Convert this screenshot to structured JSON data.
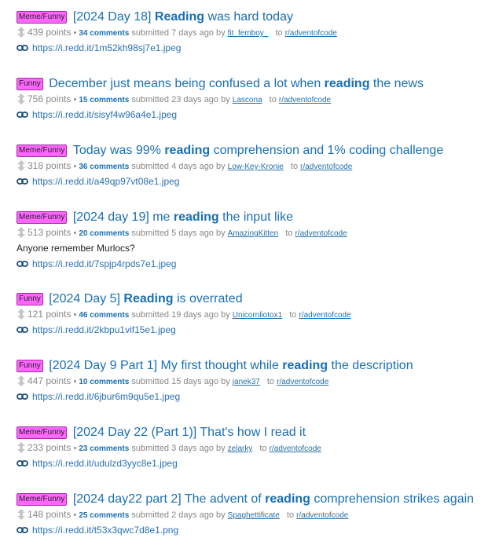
{
  "posts": [
    {
      "flair": "Meme/Funny",
      "title_segments": [
        {
          "t": "[2024 Day 18] ",
          "b": false
        },
        {
          "t": "Reading",
          "b": true
        },
        {
          "t": " was hard today",
          "b": false
        }
      ],
      "points": "439 points",
      "comments": "34 comments",
      "submitted": "submitted 7 days ago by",
      "author": "fit_femboy_",
      "to": "to",
      "subreddit": "r/adventofcode",
      "selftext": "",
      "url": "https://i.redd.it/1m52kh98sj7e1.jpeg"
    },
    {
      "flair": "Funny",
      "title_segments": [
        {
          "t": "December just means being confused a lot when ",
          "b": false
        },
        {
          "t": "reading",
          "b": true
        },
        {
          "t": " the news",
          "b": false
        }
      ],
      "points": "756 points",
      "comments": "15 comments",
      "submitted": "submitted 23 days ago by",
      "author": "Lascona",
      "to": "to",
      "subreddit": "r/adventofcode",
      "selftext": "",
      "url": "https://i.redd.it/sisyf4w96a4e1.jpeg"
    },
    {
      "flair": "Meme/Funny",
      "title_segments": [
        {
          "t": "Today was 99% ",
          "b": false
        },
        {
          "t": "reading",
          "b": true
        },
        {
          "t": " comprehension and 1% coding challenge",
          "b": false
        }
      ],
      "points": "318 points",
      "comments": "36 comments",
      "submitted": "submitted 4 days ago by",
      "author": "Low-Key-Kronie",
      "to": "to",
      "subreddit": "r/adventofcode",
      "selftext": "",
      "url": "https://i.redd.it/a49qp97vt08e1.jpeg"
    },
    {
      "flair": "Meme/Funny",
      "title_segments": [
        {
          "t": "[2024 day 19] me ",
          "b": false
        },
        {
          "t": "reading",
          "b": true
        },
        {
          "t": " the input like",
          "b": false
        }
      ],
      "points": "513 points",
      "comments": "20 comments",
      "submitted": "submitted 5 days ago by",
      "author": "AmazingKitten",
      "to": "to",
      "subreddit": "r/adventofcode",
      "selftext": "Anyone remember Murlocs?",
      "url": "https://i.redd.it/7spjp4rpds7e1.jpeg"
    },
    {
      "flair": "Funny",
      "title_segments": [
        {
          "t": "[2024 Day 5] ",
          "b": false
        },
        {
          "t": "Reading",
          "b": true
        },
        {
          "t": " is overrated",
          "b": false
        }
      ],
      "points": "121 points",
      "comments": "46 comments",
      "submitted": "submitted 19 days ago by",
      "author": "Unicornliotox1",
      "to": "to",
      "subreddit": "r/adventofcode",
      "selftext": "",
      "url": "https://i.redd.it/2kbpu1vif15e1.jpeg"
    },
    {
      "flair": "Funny",
      "title_segments": [
        {
          "t": "[2024 Day 9 Part 1] My first thought while ",
          "b": false
        },
        {
          "t": "reading",
          "b": true
        },
        {
          "t": " the description",
          "b": false
        }
      ],
      "points": "447 points",
      "comments": "10 comments",
      "submitted": "submitted 15 days ago by",
      "author": "janek37",
      "to": "to",
      "subreddit": "r/adventofcode",
      "selftext": "",
      "url": "https://i.redd.it/6jbur6m9qu5e1.jpeg"
    },
    {
      "flair": "Meme/Funny",
      "title_segments": [
        {
          "t": "[2024 Day 22 (Part 1)] That's how I read it",
          "b": false
        }
      ],
      "points": "233 points",
      "comments": "23 comments",
      "submitted": "submitted 3 days ago by",
      "author": "zelarky",
      "to": "to",
      "subreddit": "r/adventofcode",
      "selftext": "",
      "url": "https://i.redd.it/udulzd3yyc8e1.jpeg"
    },
    {
      "flair": "Meme/Funny",
      "title_segments": [
        {
          "t": "[2024 day22 part 2] The advent of ",
          "b": false
        },
        {
          "t": "reading",
          "b": true
        },
        {
          "t": " comprehension strikes again",
          "b": false
        }
      ],
      "points": "148 points",
      "comments": "25 comments",
      "submitted": "submitted 2 days ago by",
      "author": "Spaghettificate",
      "to": "to",
      "subreddit": "r/adventofcode",
      "selftext": "",
      "url": "https://i.redd.it/t53x3qwc7d8e1.png"
    }
  ]
}
